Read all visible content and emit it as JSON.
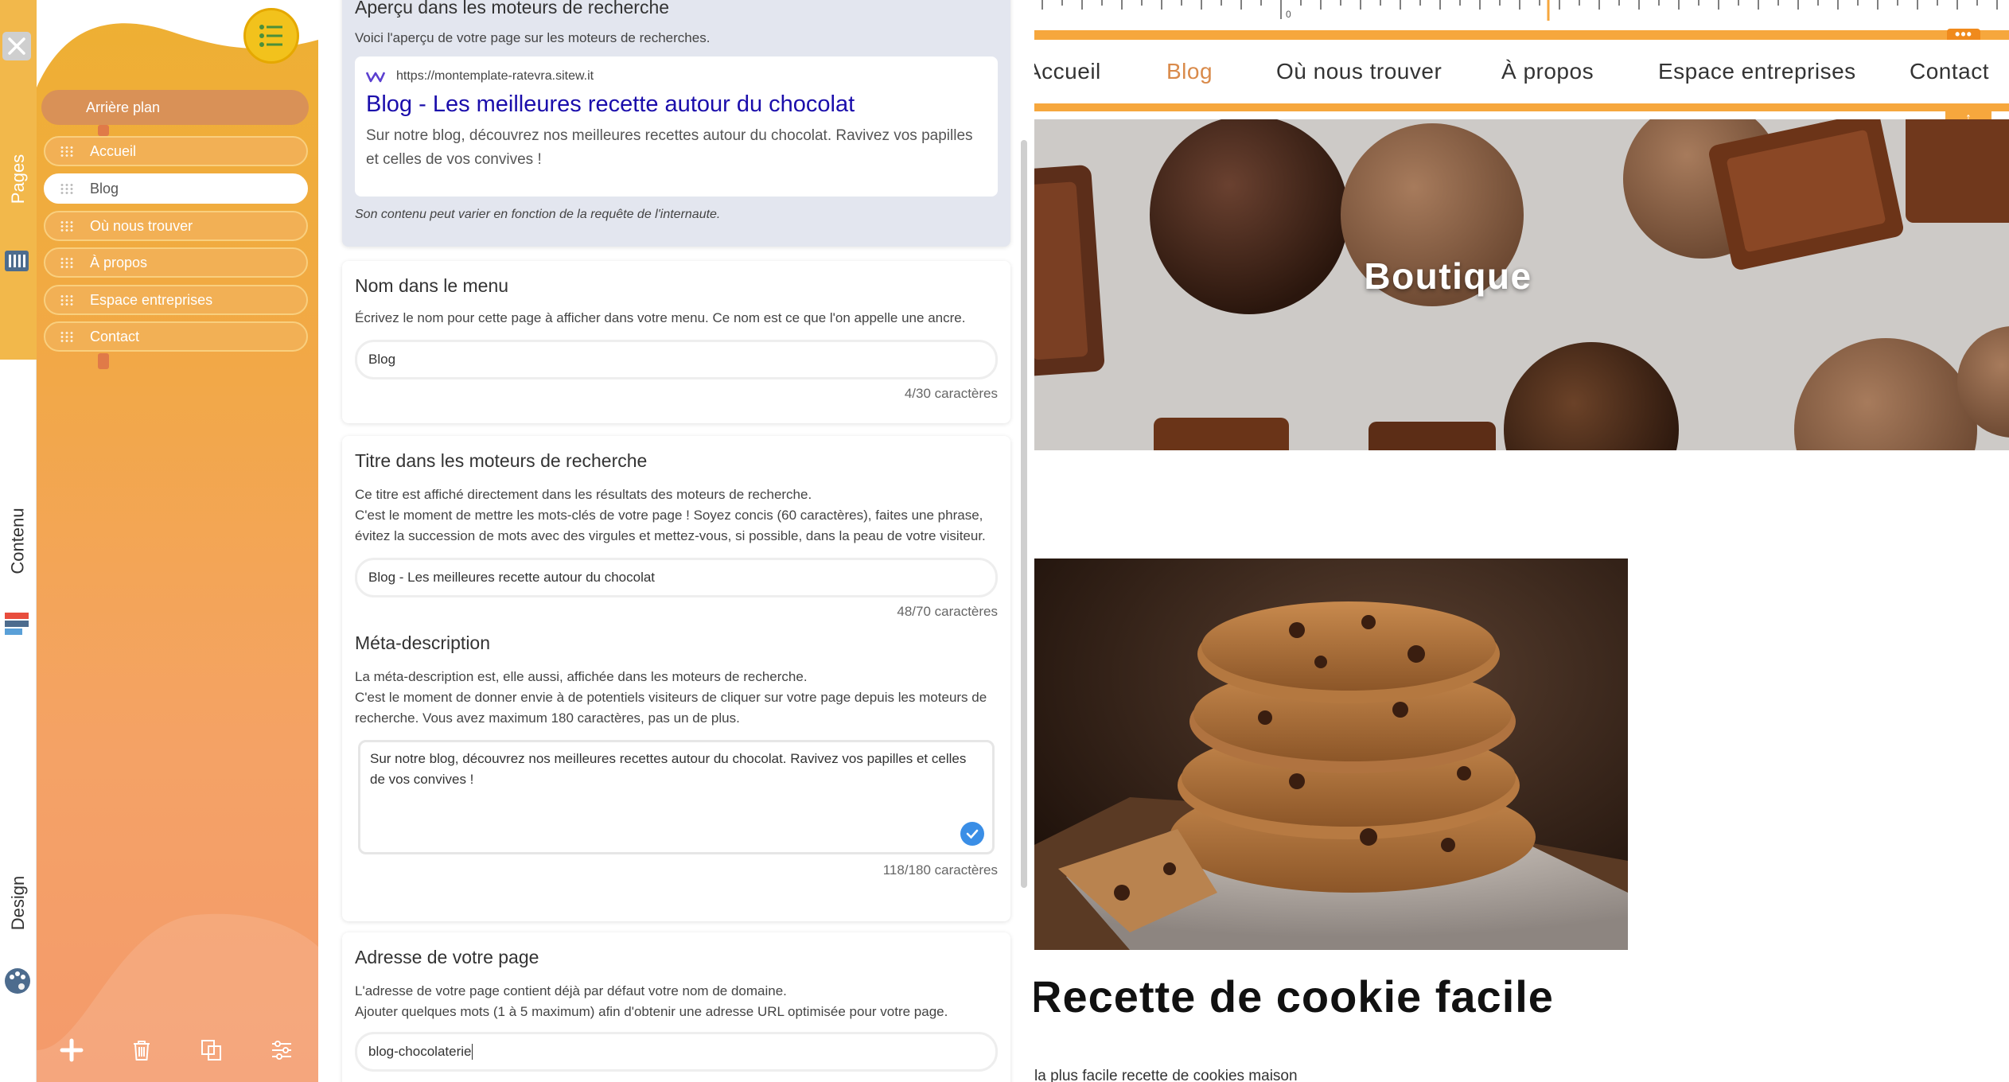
{
  "rail": {
    "tabs": [
      {
        "label": "Pages"
      },
      {
        "label": "Contenu"
      },
      {
        "label": "Design"
      }
    ]
  },
  "pages_panel": {
    "background_item": "Arrière plan",
    "pages": [
      "Accueil",
      "Blog",
      "Où nous trouver",
      "À propos",
      "Espace entreprises",
      "Contact"
    ],
    "active_page": "Blog",
    "toolbar": [
      "plus-icon",
      "trash-icon",
      "duplicate-icon",
      "sliders-icon"
    ]
  },
  "settings": {
    "preview": {
      "title": "Aperçu dans les moteurs de recherche",
      "desc": "Voici l'aperçu de votre page sur les moteurs de recherches.",
      "url": "https://montemplate-ratevra.sitew.it",
      "serp_title": "Blog - Les meilleures recette autour du chocolat",
      "serp_desc": "Sur notre blog, découvrez nos meilleures recettes autour du chocolat. Ravivez vos papilles et celles de vos convives !",
      "note": "Son contenu peut varier en fonction de la requête de l'internaute."
    },
    "menu_name": {
      "title": "Nom dans le menu",
      "desc": "Écrivez le nom pour cette page à afficher dans votre menu. Ce nom est ce que l'on appelle une ancre.",
      "value": "Blog",
      "count": "4/30 caractères"
    },
    "seo_title": {
      "title": "Titre dans les moteurs de recherche",
      "desc1": "Ce titre est affiché directement dans les résultats des moteurs de recherche.",
      "desc2": "C'est le moment de mettre les mots-clés de votre page ! Soyez concis (60 caractères), faites une phrase, évitez la succession de mots avec des virgules et mettez-vous, si possible, dans la peau de votre visiteur.",
      "value": "Blog - Les meilleures recette autour du chocolat",
      "count": "48/70 caractères"
    },
    "meta": {
      "title": "Méta-description",
      "desc1": "La méta-description est, elle aussi, affichée dans les moteurs de recherche.",
      "desc2": "C'est le moment de donner envie à de potentiels visiteurs de cliquer sur votre page depuis les moteurs de recherche. Vous avez maximum 180 caractères, pas un de plus.",
      "value": "Sur notre blog, découvrez nos meilleures recettes autour du chocolat. Ravivez vos papilles et celles de vos convives !",
      "count": "118/180 caractères"
    },
    "address": {
      "title": "Adresse de votre page",
      "desc1": "L'adresse de votre page contient déjà par défaut votre nom de domaine.",
      "desc2": "Ajouter quelques mots (1 à 5 maximum) afin d'obtenir une adresse URL optimisée pour votre page.",
      "value": "blog-chocolaterie"
    }
  },
  "site": {
    "ruler_zero": "0",
    "nav": [
      "Accueil",
      "Blog",
      "Où nous trouver",
      "À propos",
      "Espace entreprises",
      "Contact"
    ],
    "active_nav": "Blog",
    "banner_title": "Boutique",
    "recipe_title": "Recette de cookie facile",
    "recipe_sub": "la plus facile recette de cookies maison"
  },
  "colors": {
    "accent": "#f6a73d",
    "panel_top": "#eeb032",
    "panel_bottom": "#f49a6c",
    "active_nav": "#d98a4a",
    "serp_title": "#1a0dab"
  }
}
